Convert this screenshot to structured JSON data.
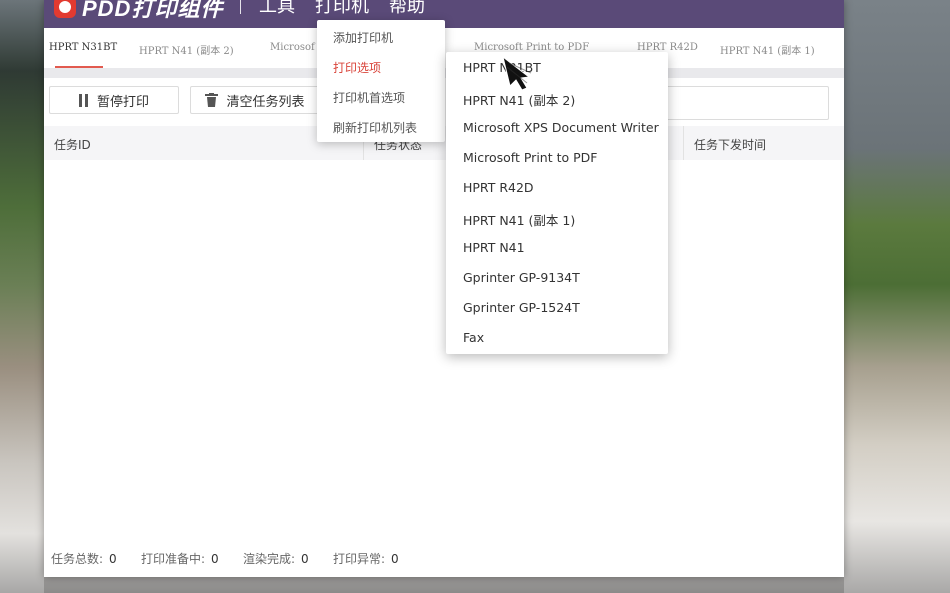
{
  "app": {
    "logo_text": "PDD打印组件"
  },
  "menubar": {
    "items": [
      "工具",
      "打印机",
      "帮助"
    ]
  },
  "tabs": [
    "HPRT N31BT",
    "HPRT N41 (副本 2)",
    "Microsof",
    "Microsoft Print to PDF",
    "HPRT R42D",
    "HPRT N41 (副本 1)"
  ],
  "toolbar": {
    "pause_label": "暂停打印",
    "clear_label": "清空任务列表"
  },
  "table": {
    "headers": [
      "任务ID",
      "任务状态",
      "任务下发时间"
    ]
  },
  "status": {
    "total_label": "任务总数:",
    "total_value": "0",
    "preparing_label": "打印准备中:",
    "preparing_value": "0",
    "rendered_label": "渲染完成:",
    "rendered_value": "0",
    "error_label": "打印异常:",
    "error_value": "0"
  },
  "printer_menu": {
    "items": [
      "添加打印机",
      "打印选项",
      "打印机首选项",
      "刷新打印机列表"
    ],
    "active_index": 1
  },
  "printer_submenu": {
    "items": [
      "HPRT N31BT",
      "HPRT N41 (副本 2)",
      "Microsoft XPS Document Writer",
      "Microsoft Print to PDF",
      "HPRT R42D",
      "HPRT N41 (副本 1)",
      "HPRT N41",
      "Gprinter GP-9134T",
      "Gprinter GP-1524T",
      "Fax"
    ]
  },
  "colors": {
    "titlebar": "#5a4a78",
    "accent": "#d9443a",
    "logo": "#e23a30"
  },
  "icons": {
    "pause": "pause-icon",
    "trash": "trash-icon",
    "cursor": "hand-cursor-icon"
  }
}
